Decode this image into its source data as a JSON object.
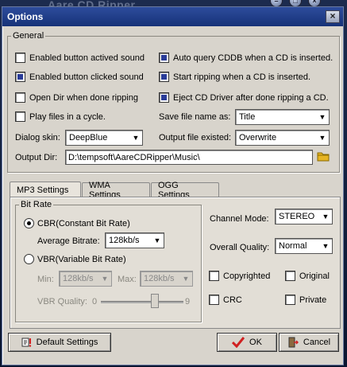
{
  "background_app": {
    "title": "Aare CD Ripper"
  },
  "dialog": {
    "title": "Options",
    "close_label": "×"
  },
  "general": {
    "legend": "General",
    "checkboxes_left": [
      {
        "label": "Enabled button actived sound",
        "checked": false
      },
      {
        "label": "Enabled button clicked sound",
        "checked": true
      },
      {
        "label": "Open Dir when done ripping",
        "checked": false
      },
      {
        "label": "Play files in a cycle.",
        "checked": false
      }
    ],
    "checkboxes_right": [
      {
        "label": "Auto query CDDB when a CD is inserted.",
        "checked": true
      },
      {
        "label": "Start ripping when a CD is inserted.",
        "checked": true
      },
      {
        "label": "Eject CD Driver after done ripping a CD.",
        "checked": true
      }
    ],
    "dialog_skin_label": "Dialog skin:",
    "dialog_skin_value": "DeepBlue",
    "save_file_name_label": "Save file name as:",
    "save_file_name_value": "Title",
    "output_file_existed_label": "Output file existed:",
    "output_file_existed_value": "Overwrite",
    "output_dir_label": "Output Dir:",
    "output_dir_value": "D:\\tempsoft\\AareCDRipper\\Music\\"
  },
  "tabs": [
    {
      "label": "MP3 Settings",
      "active": true
    },
    {
      "label": "WMA Settings",
      "active": false
    },
    {
      "label": "OGG Settings",
      "active": false
    }
  ],
  "bitrate": {
    "legend": "Bit Rate",
    "cbr_label": "CBR(Constant Bit Rate)",
    "average_bitrate_label": "Average Bitrate:",
    "average_bitrate_value": "128kb/s",
    "vbr_label": "VBR(Variable Bit Rate)",
    "min_label": "Min:",
    "min_value": "128kb/s",
    "max_label": "Max:",
    "max_value": "128kb/s",
    "vbr_quality_label": "VBR Quality:",
    "vbr_quality_min": "0",
    "vbr_quality_max": "9",
    "vbr_quality_level": 0.65
  },
  "mp3_right": {
    "channel_mode_label": "Channel Mode:",
    "channel_mode_value": "STEREO",
    "overall_quality_label": "Overall Quality:",
    "overall_quality_value": "Normal",
    "copyrighted_label": "Copyrighted",
    "original_label": "Original",
    "crc_label": "CRC",
    "private_label": "Private"
  },
  "buttons": {
    "default_settings": "Default Settings",
    "ok": "OK",
    "cancel": "Cancel"
  },
  "colors": {
    "titlebar": "#1e3a86",
    "checked_fill": "#2a3c98",
    "ok_check": "#d02020",
    "folder_icon": "#e6b422"
  }
}
